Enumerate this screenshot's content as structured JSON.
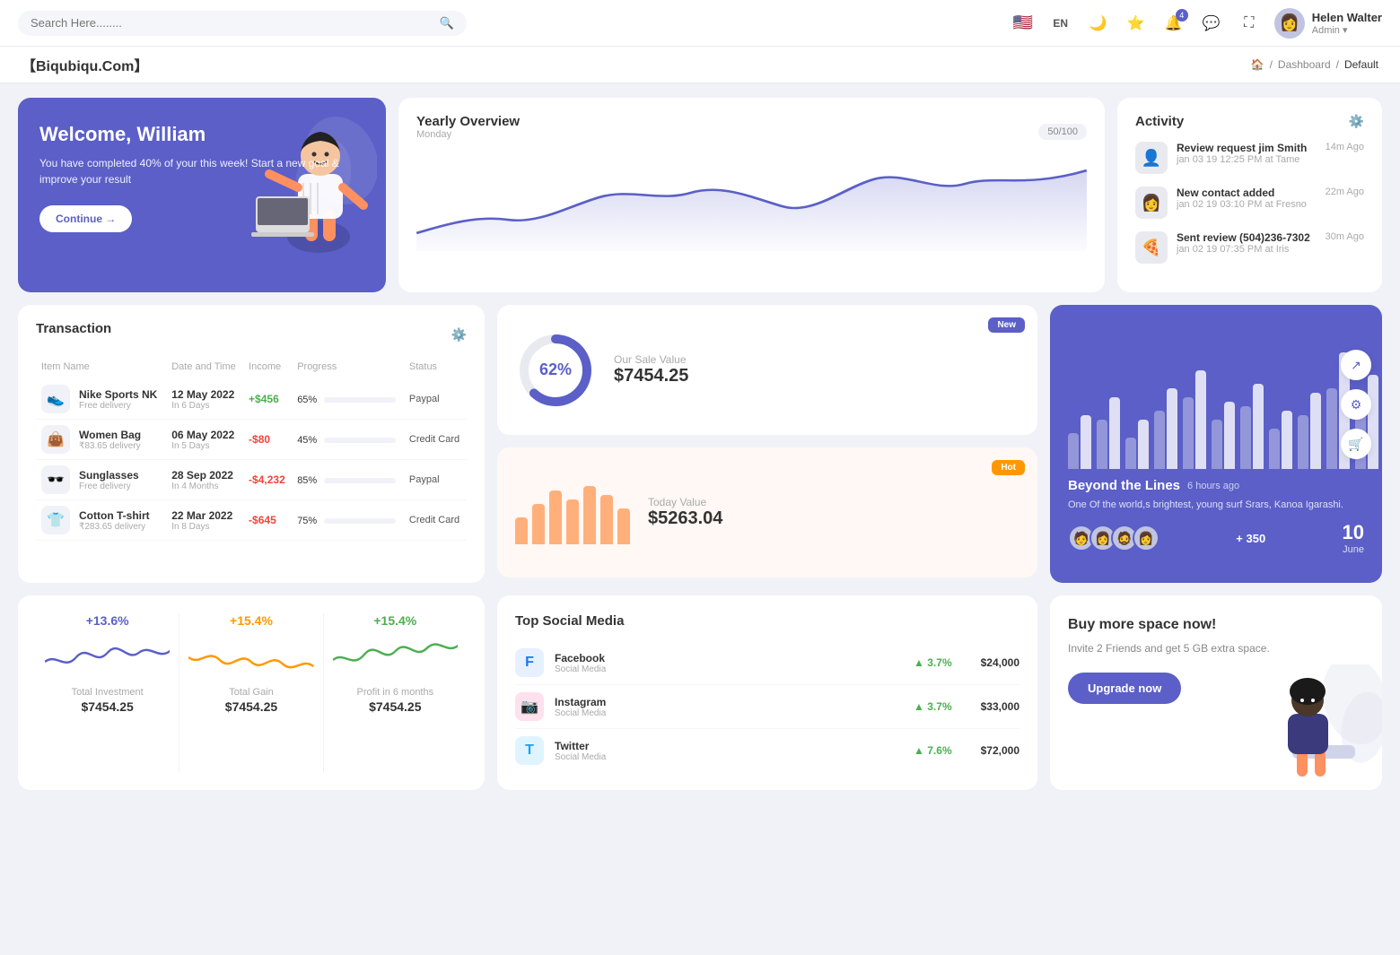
{
  "nav": {
    "search_placeholder": "Search Here........",
    "lang": "EN",
    "notification_count": "4",
    "user_name": "Helen Walter",
    "user_role": "Admin"
  },
  "breadcrumb": {
    "brand": "【Biqubiqu.Com】",
    "home": "Home",
    "dashboard": "Dashboard",
    "current": "Default"
  },
  "welcome": {
    "title": "Welcome, William",
    "subtitle": "You have completed 40% of your this week! Start a new goal & improve your result",
    "button": "Continue →"
  },
  "yearly": {
    "title": "Yearly Overview",
    "day": "Monday",
    "badge": "50/100"
  },
  "activity": {
    "title": "Activity",
    "items": [
      {
        "title": "Review request jim Smith",
        "sub": "jan 03 19 12:25 PM at Tame",
        "time": "14m Ago",
        "emoji": "👤"
      },
      {
        "title": "New contact added",
        "sub": "jan 02 19 03:10 PM at Fresno",
        "time": "22m Ago",
        "emoji": "👩"
      },
      {
        "title": "Sent review (504)236-7302",
        "sub": "jan 02 19 07:35 PM at Iris",
        "time": "30m Ago",
        "emoji": "🍕"
      }
    ]
  },
  "transaction": {
    "title": "Transaction",
    "columns": [
      "Item Name",
      "Date and Time",
      "Income",
      "Progress",
      "Status"
    ],
    "rows": [
      {
        "icon": "👟",
        "name": "Nike Sports NK",
        "sub": "Free delivery",
        "date": "12 May 2022",
        "days": "In 6 Days",
        "income": "+$456",
        "positive": true,
        "progress": 65,
        "progress_color": "#4caf50",
        "status": "Paypal"
      },
      {
        "icon": "👜",
        "name": "Women Bag",
        "sub": "₹83.65 delivery",
        "date": "06 May 2022",
        "days": "In 5 Days",
        "income": "-$80",
        "positive": false,
        "progress": 45,
        "progress_color": "#ff9800",
        "status": "Credit Card"
      },
      {
        "icon": "🕶️",
        "name": "Sunglasses",
        "sub": "Free delivery",
        "date": "28 Sep 2022",
        "days": "In 4 Months",
        "income": "-$4,232",
        "positive": false,
        "progress": 85,
        "progress_color": "#f44336",
        "status": "Paypal"
      },
      {
        "icon": "👕",
        "name": "Cotton T-shirt",
        "sub": "₹283.65 delivery",
        "date": "22 Mar 2022",
        "days": "In 8 Days",
        "income": "-$645",
        "positive": false,
        "progress": 75,
        "progress_color": "#4caf50",
        "status": "Credit Card"
      }
    ]
  },
  "sale": {
    "badge": "New",
    "percent": "62%",
    "label": "Our Sale Value",
    "value": "$7454.25",
    "donut_value": 62
  },
  "today": {
    "badge": "Hot",
    "label": "Today Value",
    "value": "$5263.04",
    "bars": [
      30,
      45,
      60,
      50,
      65,
      55,
      40
    ]
  },
  "beyond": {
    "title": "Beyond the Lines",
    "time": "6 hours ago",
    "sub": "One Of the world,s brightest, young surf Srars, Kanoa Igarashi.",
    "plus": "+ 350",
    "date_day": "10",
    "date_month": "June",
    "avatars": [
      "🧑",
      "👩",
      "🧔",
      "👩"
    ]
  },
  "stats": [
    {
      "pct": "+13.6%",
      "color": "purple",
      "label": "Total Investment",
      "value": "$7454.25",
      "wave_color": "#5b5fc7"
    },
    {
      "pct": "+15.4%",
      "color": "orange",
      "label": "Total Gain",
      "value": "$7454.25",
      "wave_color": "#ff9800"
    },
    {
      "pct": "+15.4%",
      "color": "green",
      "label": "Profit in 6 months",
      "value": "$7454.25",
      "wave_color": "#4caf50"
    }
  ],
  "social": {
    "title": "Top Social Media",
    "items": [
      {
        "name": "Facebook",
        "sub": "Social Media",
        "pct": "3.7%",
        "value": "$24,000",
        "icon": "f",
        "color": "#1877f2",
        "bg": "#e7f0ff"
      },
      {
        "name": "Instagram",
        "sub": "Social Media",
        "pct": "3.7%",
        "value": "$33,000",
        "icon": "📷",
        "color": "#e1306c",
        "bg": "#ffe0ed"
      },
      {
        "name": "Twitter",
        "sub": "Social Media",
        "pct": "7.6%",
        "value": "$72,000",
        "icon": "t",
        "color": "#1da1f2",
        "bg": "#e0f4ff"
      }
    ]
  },
  "upgrade": {
    "title": "Buy more space now!",
    "sub": "Invite 2 Friends and get 5 GB extra space.",
    "button": "Upgrade now"
  }
}
